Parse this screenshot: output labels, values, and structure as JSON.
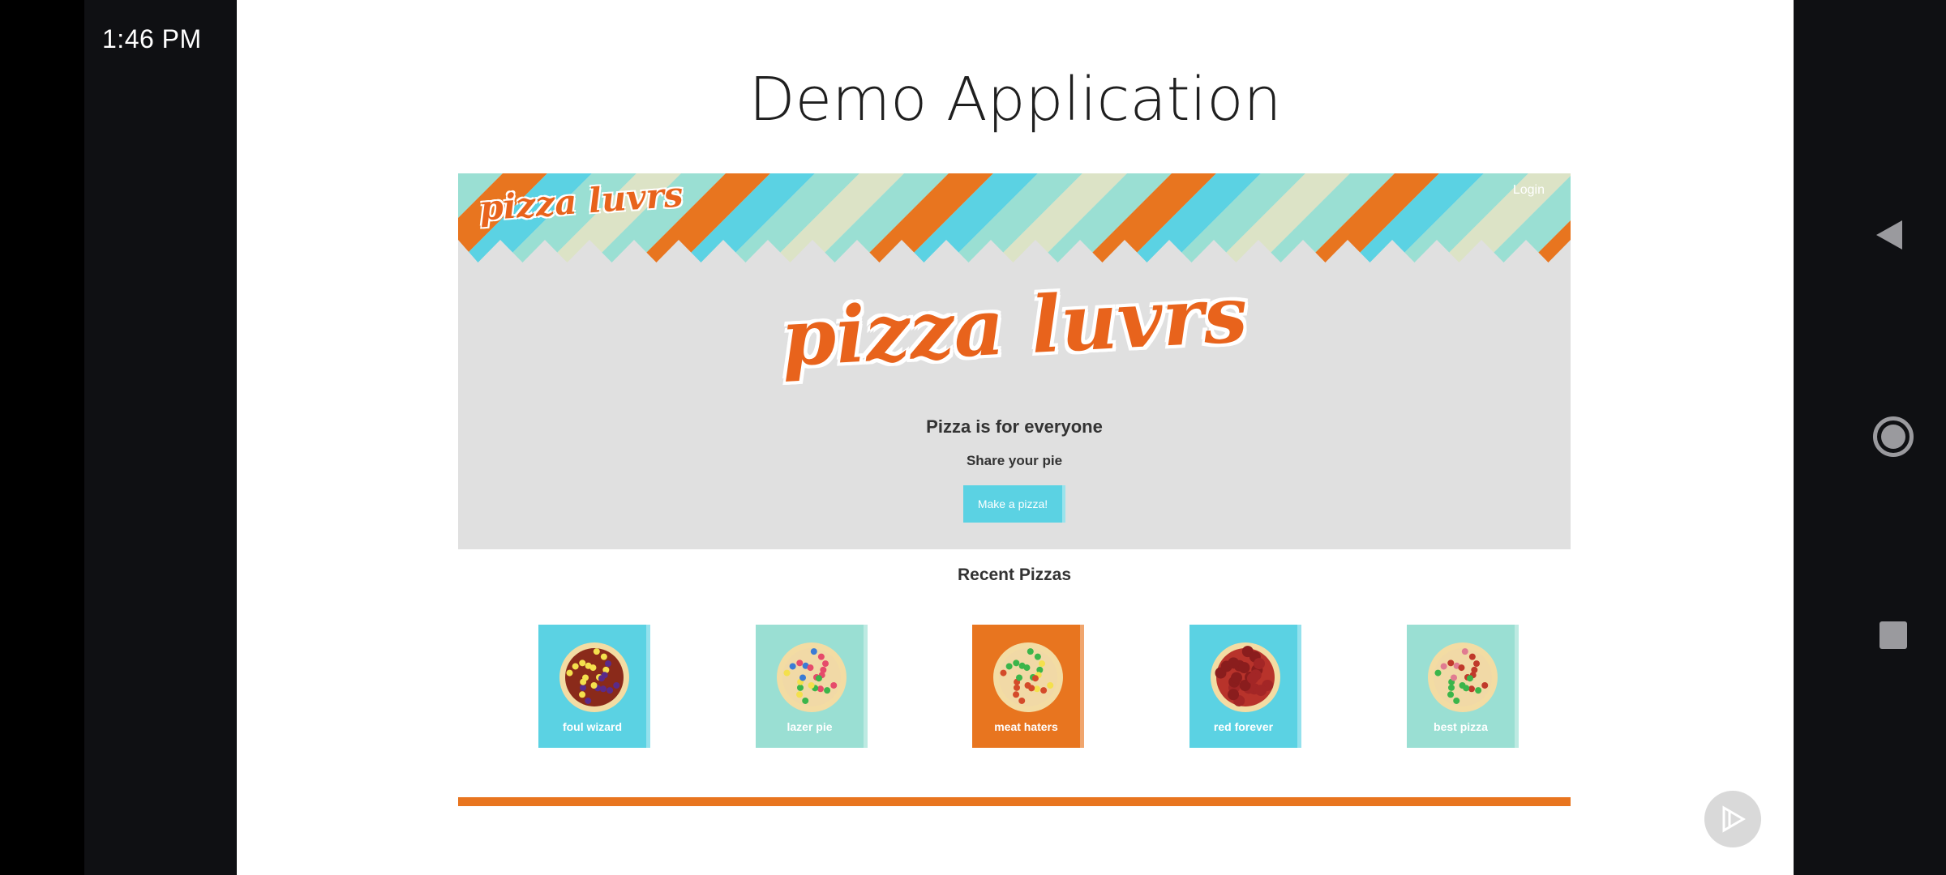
{
  "status_bar": {
    "time": "1:46 PM"
  },
  "slide": {
    "title": "Demo Application"
  },
  "webapp": {
    "nav": {
      "logo_text": "pizza luvrs",
      "login_label": "Login"
    },
    "hero": {
      "logo_text": "pizza luvrs",
      "heading": "Pizza is for everyone",
      "subheading": "Share your pie",
      "cta_label": "Make a pizza!"
    },
    "recent": {
      "heading": "Recent Pizzas",
      "pizzas": [
        {
          "name": "foul wizard",
          "bg": "#5bd2e3"
        },
        {
          "name": "lazer pie",
          "bg": "#9adfd3"
        },
        {
          "name": "meat haters",
          "bg": "#e8751f"
        },
        {
          "name": "red forever",
          "bg": "#5bd2e3"
        },
        {
          "name": "best pizza",
          "bg": "#9adfd3"
        }
      ]
    }
  },
  "colors": {
    "brand_orange": "#e8751f",
    "brand_cyan": "#5bd2e3",
    "brand_mint": "#9adfd3",
    "brand_cream": "#dce3c6",
    "hero_gray": "#e0e0e0"
  },
  "system_nav": {
    "back_icon": "triangle-back",
    "home_icon": "circle-home",
    "recents_icon": "square-recents"
  }
}
